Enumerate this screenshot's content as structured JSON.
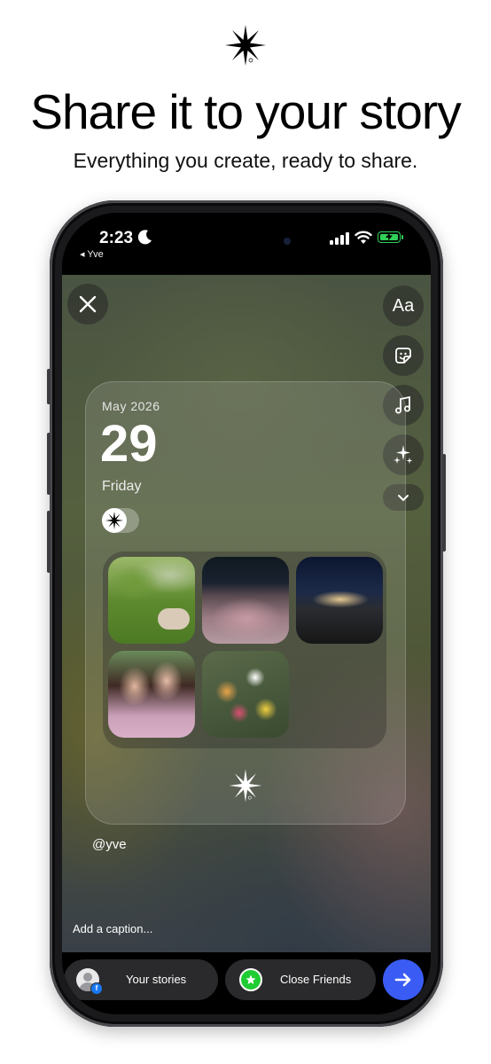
{
  "hero": {
    "logo_icon": "sparkle-star-logo",
    "title": "Share it to your story",
    "subtitle": "Everything you create, ready to share."
  },
  "status_bar": {
    "time": "2:23",
    "carrier": "◂ Yve",
    "icons": [
      "moon-icon",
      "signal-icon",
      "wifi-icon",
      "battery-charging-icon"
    ]
  },
  "story_editor": {
    "tools": {
      "text_label": "Aa",
      "icons": [
        "text-icon",
        "sticker-icon",
        "music-icon",
        "effects-sparkles-icon",
        "chevron-down-icon"
      ]
    },
    "card": {
      "month": "May 2026",
      "day": "29",
      "weekday": "Friday",
      "photos": [
        "park-picnic-photo",
        "flower-field-night-photo",
        "night-city-photo",
        "friends-selfie-photo",
        "flower-bouquet-photo"
      ]
    },
    "handle": "@yve",
    "caption_placeholder": "Add a caption..."
  },
  "share_bar": {
    "your_stories": "Your stories",
    "close_friends": "Close Friends",
    "send_icon": "arrow-right-icon"
  },
  "colors": {
    "send_button": "#3a5cf5",
    "close_friends": "#1fcc32",
    "battery": "#30d158",
    "facebook_badge": "#1877f2"
  }
}
